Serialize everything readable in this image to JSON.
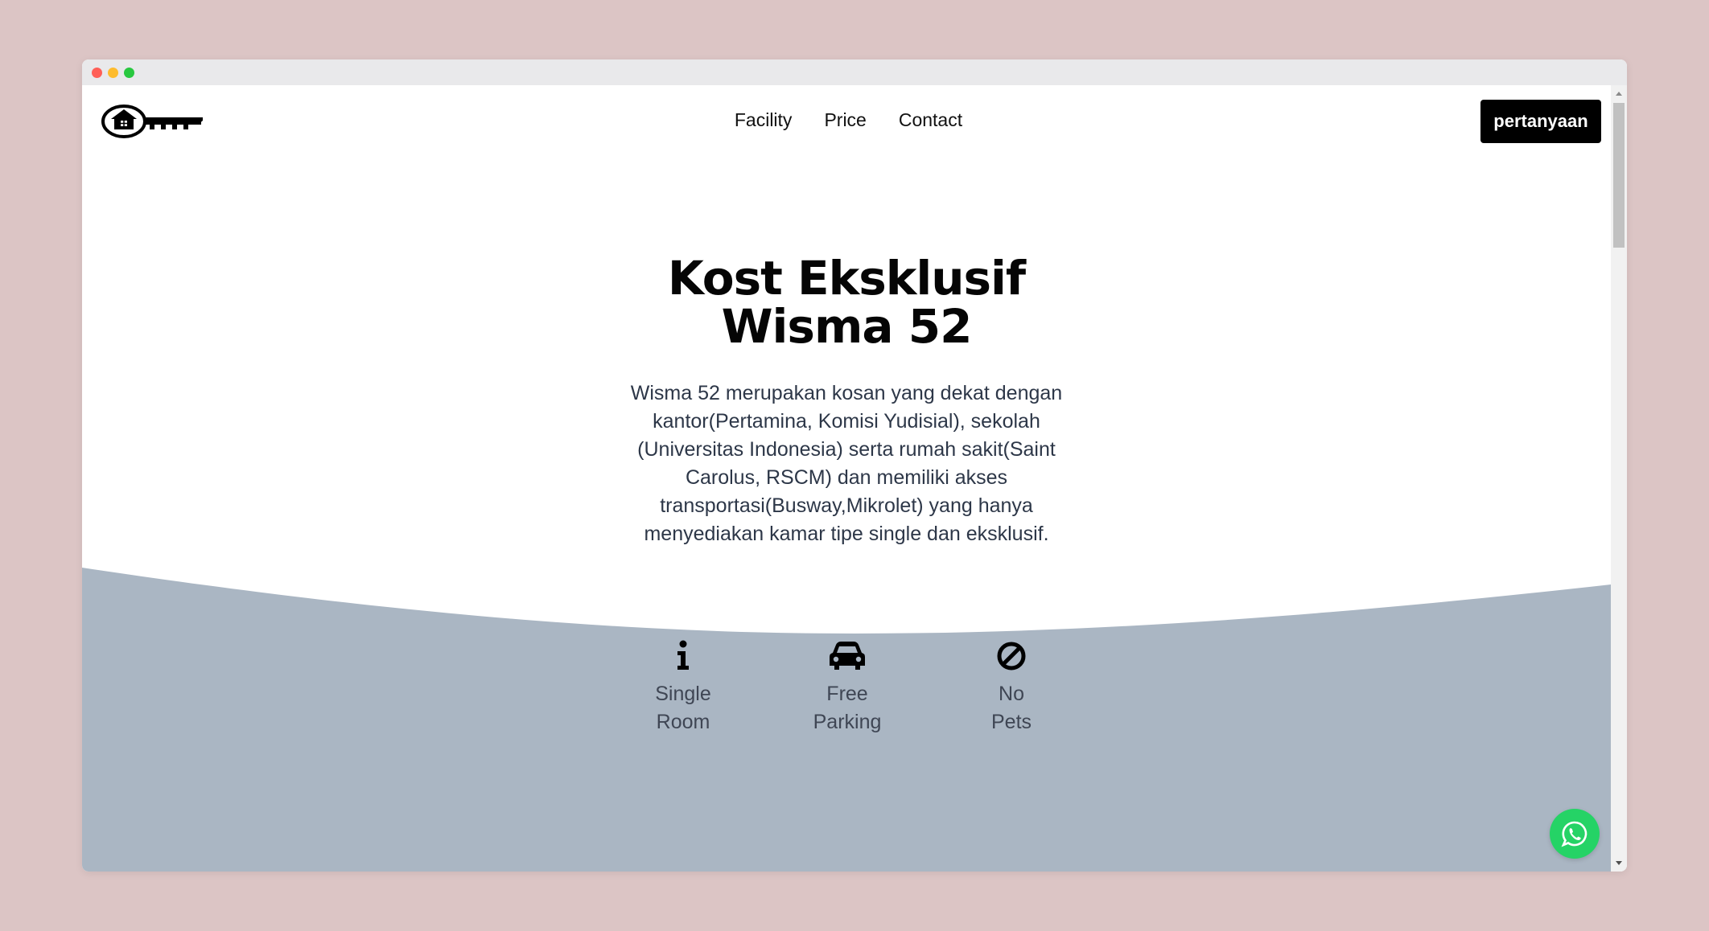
{
  "nav": {
    "links": [
      "Facility",
      "Price",
      "Contact"
    ],
    "cta_label": "pertanyaan"
  },
  "hero": {
    "title_line1": "Kost Eksklusif",
    "title_line2": "Wisma 52",
    "description": "Wisma 52 merupakan kosan yang dekat dengan kantor(Pertamina, Komisi Yudisial), sekolah (Universitas Indonesia) serta rumah sakit(Saint Carolus, RSCM) dan memiliki akses transportasi(Busway,Mikrolet) yang hanya menyediakan kamar tipe single dan eksklusif."
  },
  "features": [
    {
      "icon": "info-icon",
      "line1": "Single",
      "line2": "Room"
    },
    {
      "icon": "car-icon",
      "line1": "Free",
      "line2": "Parking"
    },
    {
      "icon": "ban-icon",
      "line1": "No",
      "line2": "Pets"
    }
  ],
  "floating": {
    "icon": "whatsapp-icon"
  },
  "colors": {
    "page_background": "#dcc5c5",
    "wave": "#aab6c3",
    "cta_background": "#000000",
    "whatsapp": "#25d366"
  }
}
